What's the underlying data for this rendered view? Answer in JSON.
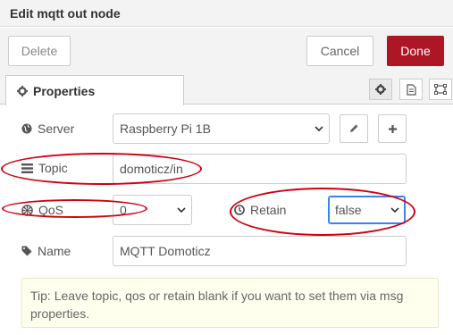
{
  "dialog": {
    "title": "Edit mqtt out node"
  },
  "toolbar": {
    "delete_label": "Delete",
    "cancel_label": "Cancel",
    "done_label": "Done"
  },
  "tabs": {
    "properties_label": "Properties",
    "icons": [
      "gear-icon",
      "document-icon",
      "frame-icon"
    ]
  },
  "form": {
    "server": {
      "label": "Server",
      "value": "Raspberry Pi 1B"
    },
    "topic": {
      "label": "Topic",
      "value": "domoticz/in"
    },
    "qos": {
      "label": "QoS",
      "value": "0"
    },
    "retain": {
      "label": "Retain",
      "value": "false"
    },
    "name": {
      "label": "Name",
      "value": "MQTT Domoticz"
    }
  },
  "tip": {
    "text": "Tip: Leave topic, qos or retain blank if you want to set them via msg properties."
  },
  "colors": {
    "done_bg": "#ad1625",
    "annotation": "#d00010",
    "tip_bg": "#ffffee"
  }
}
